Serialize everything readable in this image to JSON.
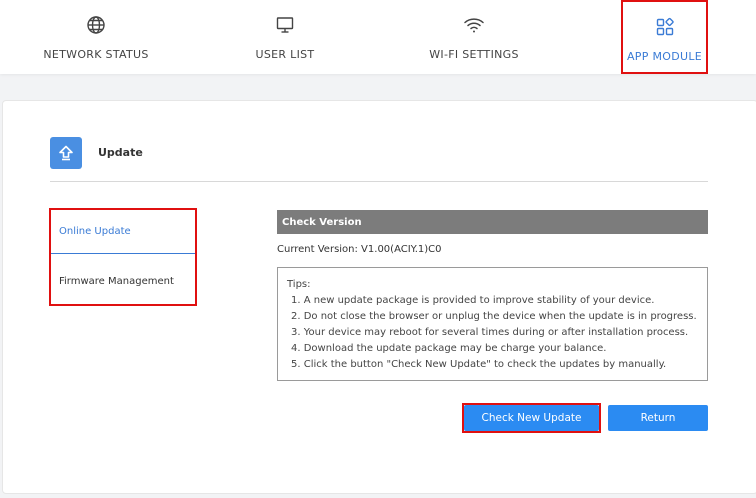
{
  "nav": {
    "items": [
      {
        "label": "NETWORK STATUS",
        "icon": "globe-icon"
      },
      {
        "label": "USER LIST",
        "icon": "monitor-icon"
      },
      {
        "label": "WI-FI SETTINGS",
        "icon": "wifi-icon"
      },
      {
        "label": "APP MODULE",
        "icon": "apps-grid-icon",
        "active": true
      }
    ]
  },
  "page": {
    "title": "Update",
    "icon": "upload-arrow-icon"
  },
  "sidebar": {
    "items": [
      {
        "label": "Online Update",
        "active": true
      },
      {
        "label": "Firmware Management"
      }
    ]
  },
  "check_version": {
    "header": "Check Version",
    "current_version": "Current Version: V1.00(ACIY.1)C0"
  },
  "tips": {
    "heading": "Tips:",
    "items": [
      "1. A new update package is provided to improve stability of your device.",
      "2. Do not close the browser or unplug the device when the update is in progress.",
      "3. Your device may reboot for several times during or after installation process.",
      "4. Download the update package may be charge your balance.",
      "5. Click the button \"Check New Update\" to check the updates by manually."
    ]
  },
  "buttons": {
    "check_new_update": "Check New Update",
    "return": "Return"
  },
  "colors": {
    "accent": "#3a7bd5",
    "button": "#2b8bf2",
    "highlight": "#e01010",
    "bar": "#7c7c7c"
  }
}
